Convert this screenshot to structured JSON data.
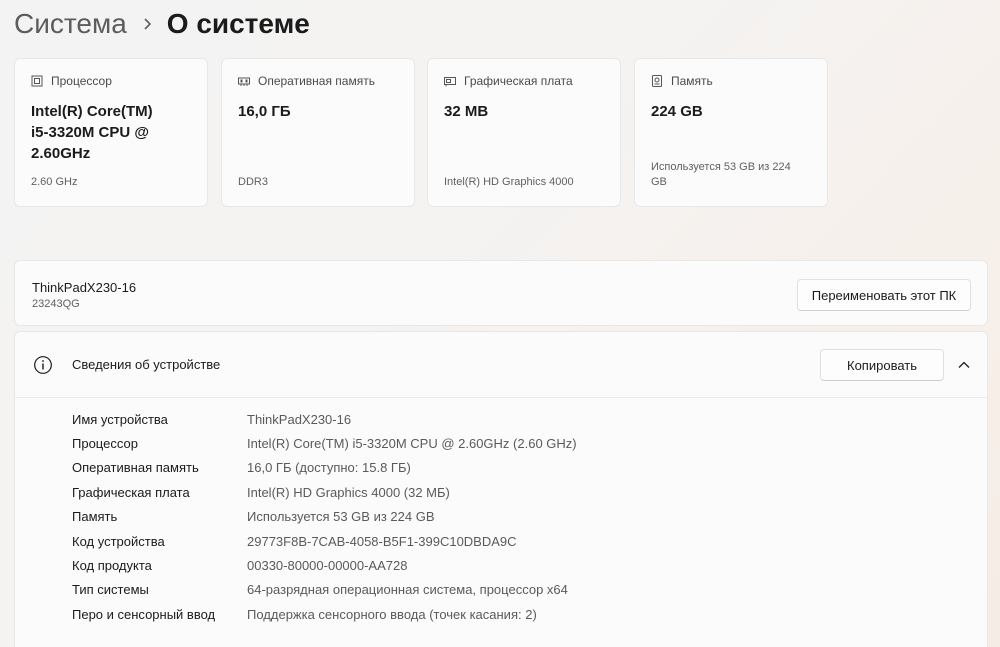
{
  "breadcrumb": {
    "parent": "Система",
    "current": "О системе"
  },
  "specs": [
    {
      "icon": "cpu-icon",
      "title": "Процессор",
      "value": "Intel(R) Core(TM) i5-3320M CPU @ 2.60GHz",
      "sub": "2.60 GHz"
    },
    {
      "icon": "memory-icon",
      "title": "Оперативная память",
      "value": "16,0 ГБ",
      "sub": "DDR3"
    },
    {
      "icon": "gpu-icon",
      "title": "Графическая плата",
      "value": "32 MB",
      "sub": "Intel(R) HD Graphics 4000"
    },
    {
      "icon": "storage-icon",
      "title": "Память",
      "value": "224 GB",
      "sub": "Используется 53 GB из 224 GB"
    }
  ],
  "device": {
    "name": "ThinkPadX230-16",
    "model": "23243QG",
    "rename_label": "Переименовать этот ПК"
  },
  "device_info": {
    "title": "Сведения об устройстве",
    "copy_label": "Копировать",
    "rows": [
      {
        "label": "Имя устройства",
        "value": "ThinkPadX230-16"
      },
      {
        "label": "Процессор",
        "value": "Intel(R) Core(TM) i5-3320M CPU @ 2.60GHz (2.60 GHz)"
      },
      {
        "label": "Оперативная память",
        "value": "16,0 ГБ (доступно: 15.8 ГБ)"
      },
      {
        "label": "Графическая плата",
        "value": "Intel(R) HD Graphics 4000 (32 МБ)"
      },
      {
        "label": "Память",
        "value": "Используется 53 GB из 224 GB"
      },
      {
        "label": "Код устройства",
        "value": "29773F8B-7CAB-4058-B5F1-399C10DBDA9C"
      },
      {
        "label": "Код продукта",
        "value": "00330-80000-00000-AA728"
      },
      {
        "label": "Тип системы",
        "value": "64-разрядная операционная система, процессор x64"
      },
      {
        "label": "Перо и сенсорный ввод",
        "value": "Поддержка сенсорного ввода (точек касания: 2)"
      }
    ]
  }
}
